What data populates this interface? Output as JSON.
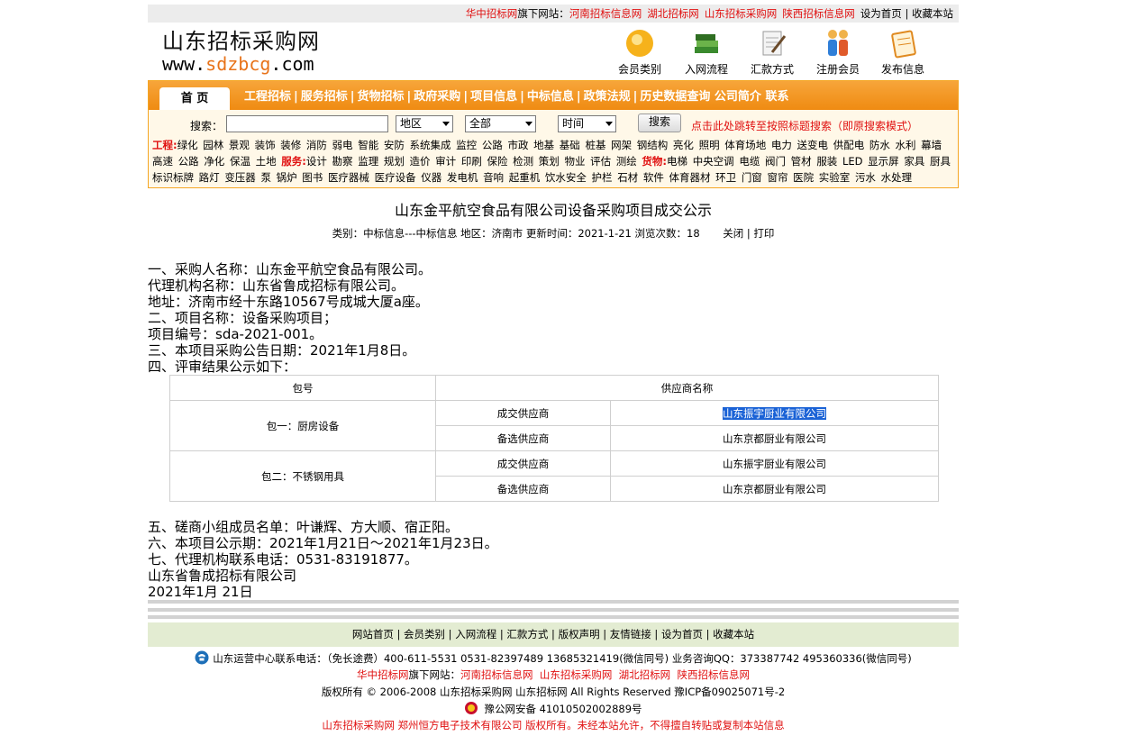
{
  "topbar": {
    "prefix": "华中招标网",
    "suffix_label": "旗下网站：",
    "sites": [
      "河南招标信息网",
      "湖北招标网",
      "山东招标采购网",
      "陕西招标信息网"
    ],
    "links": [
      "设为首页",
      "收藏本站"
    ]
  },
  "header": {
    "logo_cn": "山东招标采购网",
    "logo_www": "www.",
    "logo_domain": "sdzbcg",
    "logo_tld": ".com",
    "icons": [
      {
        "label": "会员类别",
        "icon": "coins-icon"
      },
      {
        "label": "入网流程",
        "icon": "books-icon"
      },
      {
        "label": "汇款方式",
        "icon": "document-pen-icon"
      },
      {
        "label": "注册会员",
        "icon": "people-icon"
      },
      {
        "label": "发布信息",
        "icon": "notepad-icon"
      }
    ]
  },
  "nav": {
    "home": "首 页",
    "items": [
      "工程招标",
      "服务招标",
      "货物招标",
      "政府采购",
      "项目信息",
      "中标信息",
      "政策法规",
      "历史数据查询"
    ],
    "extra": [
      "公司简介",
      "联系"
    ]
  },
  "search": {
    "label": "搜索：",
    "keyword_value": "",
    "region": "地区",
    "scope": "全部",
    "time": "时间",
    "button": "搜索",
    "tip": "点击此处跳转至按照标题搜索（即原搜索模式）"
  },
  "categories": {
    "engineering_label": "工程:",
    "engineering": [
      "绿化",
      "园林",
      "景观",
      "装饰",
      "装修",
      "消防",
      "弱电",
      "智能",
      "安防",
      "系统集成",
      "监控",
      "公路",
      "市政",
      "地基",
      "基础",
      "桩基",
      "网架",
      "钢结构",
      "亮化",
      "照明",
      "体育场地",
      "电力",
      "送变电",
      "供配电",
      "防水",
      "水利",
      "幕墙",
      "高速",
      "公路",
      "净化",
      "保温",
      "土地"
    ],
    "service_label": "服务:",
    "service": [
      "设计",
      "勘察",
      "监理",
      "规划",
      "造价",
      "审计",
      "印刷",
      "保险",
      "检测",
      "策划",
      "物业",
      "评估",
      "测绘"
    ],
    "goods_label": "货物:",
    "goods": [
      "电梯",
      "中央空调",
      "电缆",
      "阀门",
      "管材",
      "服装",
      "LED",
      "显示屏",
      "家具",
      "厨具",
      "标识标牌",
      "路灯",
      "变压器",
      "泵",
      "锅炉",
      "图书",
      "医疗器械",
      "医疗设备",
      "仪器",
      "发电机",
      "音响",
      "起重机",
      "饮水安全",
      "护栏",
      "石材",
      "软件",
      "体育器材",
      "环卫",
      "门窗",
      "窗帘",
      "医院",
      "实验室",
      "污水",
      "水处理"
    ]
  },
  "article": {
    "title": "山东金平航空食品有限公司设备采购项目成交公示",
    "meta": "类别：中标信息---中标信息  地区：济南市  更新时间：2021-1-21 浏览次数：18",
    "meta_links": [
      "关闭",
      "打印"
    ],
    "lines": [
      "一、采购人名称：山东金平航空食品有限公司。",
      "代理机构名称：山东省鲁成招标有限公司。",
      "地址：济南市经十东路10567号成城大厦a座。",
      "二、项目名称：设备采购项目；",
      "项目编号：sda-2021-001。",
      "三、本项目采购公告日期：2021年1月8日。",
      "四、评审结果公示如下："
    ],
    "table": {
      "headers": [
        "包号",
        "供应商名称"
      ],
      "packages": [
        {
          "name": "包一：厨房设备",
          "rows": [
            {
              "role": "成交供应商",
              "supplier": "山东振宇厨业有限公司"
            },
            {
              "role": "备选供应商",
              "supplier": "山东京都厨业有限公司"
            }
          ]
        },
        {
          "name": "包二：不锈钢用具",
          "rows": [
            {
              "role": "成交供应商",
              "supplier": "山东振宇厨业有限公司"
            },
            {
              "role": "备选供应商",
              "supplier": "山东京都厨业有限公司"
            }
          ]
        }
      ]
    },
    "lines2": [
      "五、磋商小组成员名单：叶谦辉、方大顺、宿正阳。",
      "六、本项目公示期：2021年1月21日～2021年1月23日。",
      "七、代理机构联系电话：0531-83191877。",
      "山东省鲁成招标有限公司",
      "2021年1月 21日"
    ]
  },
  "footer": {
    "nav": [
      "网站首页",
      "会员类别",
      "入网流程",
      "汇款方式",
      "版权声明",
      "友情链接",
      "设为首页",
      "收藏本站"
    ],
    "contact": "山东运营中心联系电话：（免长途费）400-611-5531 0531-82397489 13685321419(微信同号) 业务咨询QQ：373387742    495360336(微信同号)",
    "sister_prefix": "华中招标网",
    "sister_label": "旗下网站：",
    "sister_sites": [
      "河南招标信息网",
      "山东招标采购网",
      "湖北招标网",
      "陕西招标信息网"
    ],
    "copyright": "版权所有 © 2006-2008 山东招标采购网 山东招标网 All Rights Reserved 豫ICP备09025071号-2",
    "police": "豫公网安备 41010502002889号",
    "notice": "山东招标采购网 郑州恒方电子技术有限公司 版权所有。未经本站允许，不得擅自转贴或复制本站信息"
  },
  "colors": {
    "accent": "#ef8b12",
    "red": "#e01010",
    "highlight": "#1a62d6",
    "footer_bg": "#e3ecd2"
  }
}
